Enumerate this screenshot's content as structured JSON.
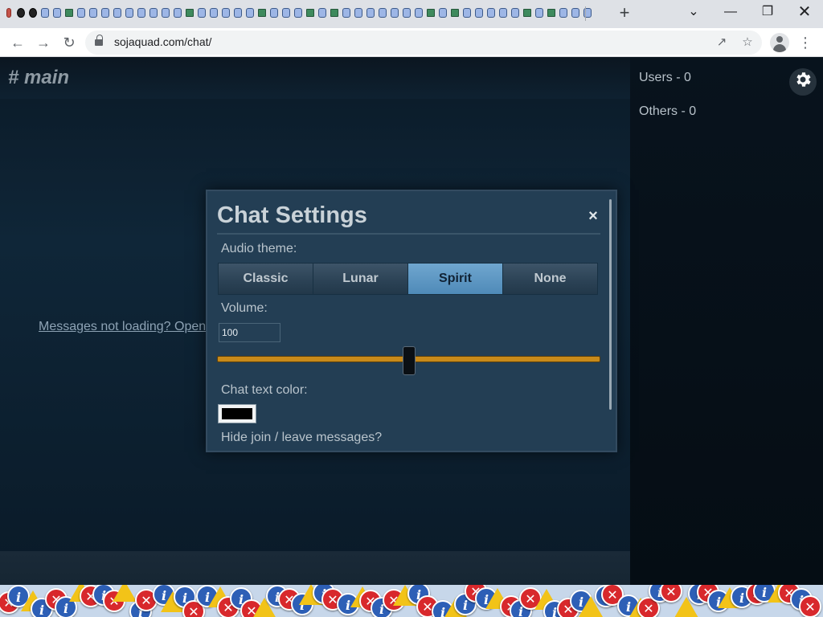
{
  "browser": {
    "tab_favicons": [
      "torch",
      "dark",
      "dark",
      "tab",
      "tab",
      "green",
      "tab",
      "tab",
      "tab",
      "tab",
      "tab",
      "tab",
      "tab",
      "tab",
      "tab",
      "green",
      "tab",
      "tab",
      "tab",
      "tab",
      "tab",
      "green",
      "tab",
      "tab",
      "tab",
      "green",
      "tab",
      "green",
      "tab",
      "tab",
      "tab",
      "tab",
      "tab",
      "tab",
      "tab",
      "green",
      "tab",
      "green",
      "tab",
      "tab",
      "tab",
      "tab",
      "tab",
      "green",
      "tab",
      "green",
      "tab",
      "tab",
      "tab"
    ],
    "new_tab_icon": "+",
    "url": "sojaquad.com/chat/"
  },
  "chat": {
    "channel": "# main",
    "legacy_link": "Messages not loading? Open the legacy version here."
  },
  "userlist": {
    "users": "Users - 0",
    "others": "Others - 0"
  },
  "settings_modal": {
    "title": "Chat Settings",
    "close": "×",
    "audio_theme_label": "Audio theme:",
    "audio_themes": [
      "Classic",
      "Lunar",
      "Spirit",
      "None"
    ],
    "selected_theme": "Spirit",
    "volume_label": "Volume:",
    "volume_value": "100",
    "volume_fraction": 0.5,
    "chat_text_color_label": "Chat text color:",
    "chat_text_color": "#000000",
    "hide_join_label": "Hide join / leave messages?"
  },
  "colors": {
    "accent": "#4f8ab8",
    "slider": "#c88a1a",
    "modal_bg": "#233e54"
  }
}
